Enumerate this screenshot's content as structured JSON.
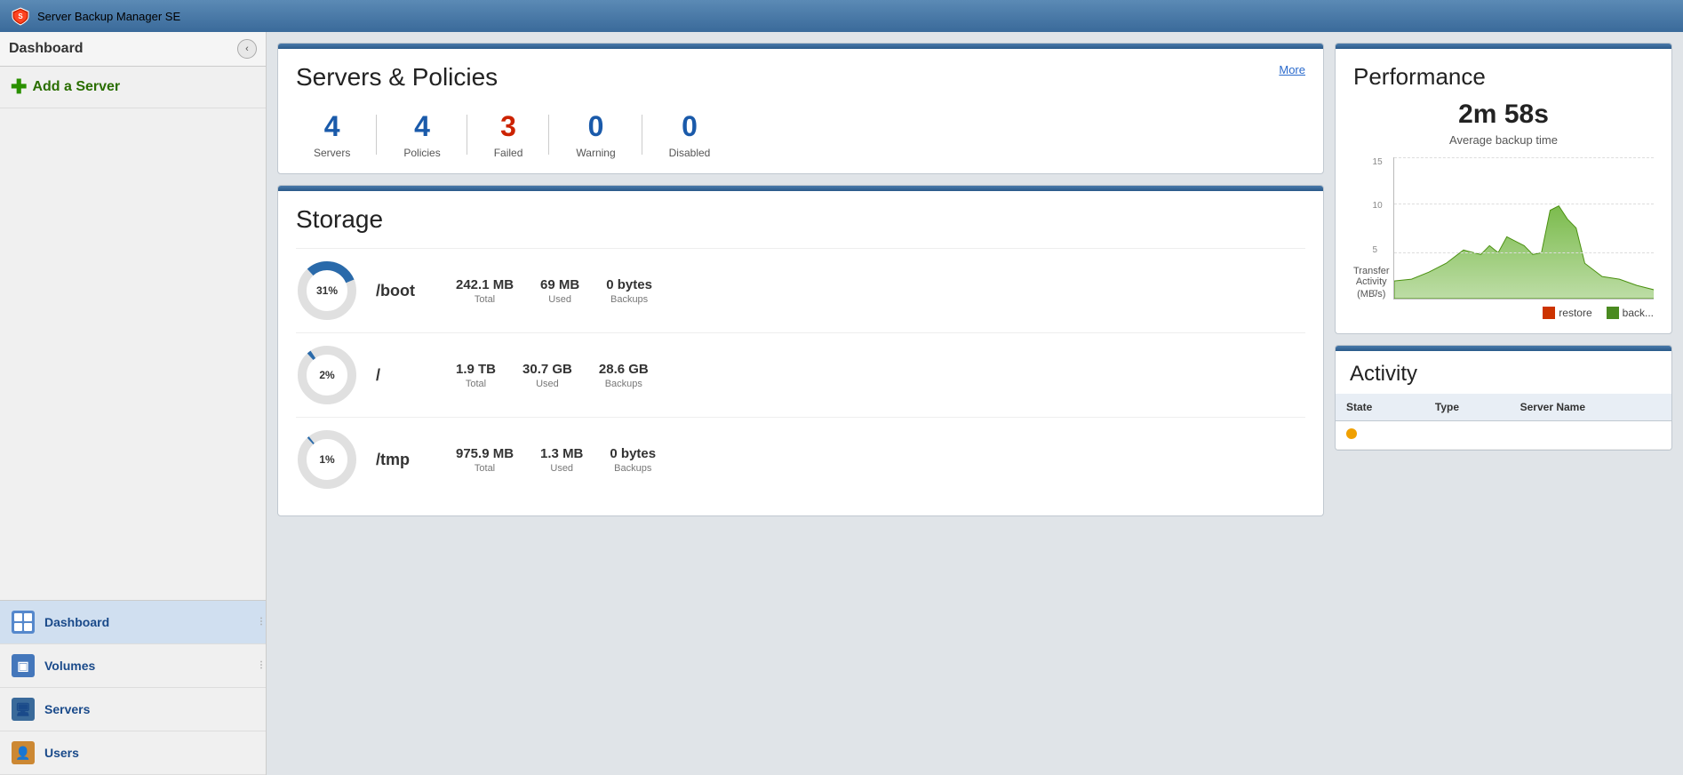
{
  "app": {
    "title": "Server Backup Manager SE"
  },
  "sidebar": {
    "title": "Dashboard",
    "add_server_label": "Add a Server",
    "nav_items": [
      {
        "id": "dashboard",
        "label": "Dashboard",
        "active": true
      },
      {
        "id": "volumes",
        "label": "Volumes",
        "active": false
      },
      {
        "id": "servers",
        "label": "Servers",
        "active": false
      },
      {
        "id": "users",
        "label": "Users",
        "active": false
      }
    ]
  },
  "servers_policies": {
    "title": "Servers & Policies",
    "more_label": "More",
    "stats": [
      {
        "value": "4",
        "label": "Servers",
        "color": "blue"
      },
      {
        "value": "4",
        "label": "Policies",
        "color": "blue"
      },
      {
        "value": "3",
        "label": "Failed",
        "color": "red"
      },
      {
        "value": "0",
        "label": "Warning",
        "color": "blue"
      },
      {
        "value": "0",
        "label": "Disabled",
        "color": "blue"
      }
    ]
  },
  "storage": {
    "title": "Storage",
    "rows": [
      {
        "percent": 31,
        "mount": "/boot",
        "total_value": "242.1 MB",
        "total_label": "Total",
        "used_value": "69 MB",
        "used_label": "Used",
        "backups_value": "0 bytes",
        "backups_label": "Backups"
      },
      {
        "percent": 2,
        "mount": "/",
        "total_value": "1.9 TB",
        "total_label": "Total",
        "used_value": "30.7 GB",
        "used_label": "Used",
        "backups_value": "28.6 GB",
        "backups_label": "Backups"
      },
      {
        "percent": 1,
        "mount": "/tmp",
        "total_value": "975.9 MB",
        "total_label": "Total",
        "used_value": "1.3 MB",
        "used_label": "Used",
        "backups_value": "0 bytes",
        "backups_label": "Backups"
      }
    ]
  },
  "performance": {
    "title": "Performance",
    "avg_time": "2m 58s",
    "avg_time_label": "Average backup time",
    "chart_label": "Transfer\nActivity",
    "chart_y_labels": [
      "15",
      "10",
      "5",
      "0"
    ],
    "chart_unit": "MB/s",
    "legend": [
      {
        "label": "restore",
        "color": "#cc3300"
      },
      {
        "label": "back...",
        "color": "#4a8a20"
      }
    ]
  },
  "activity": {
    "title": "Activity",
    "columns": [
      "State",
      "Type",
      "Server Name"
    ],
    "rows": [
      {
        "state": "running",
        "type": "",
        "server_name": ""
      }
    ]
  },
  "back_button": "back"
}
